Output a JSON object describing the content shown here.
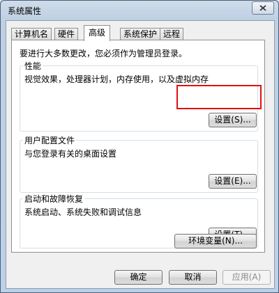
{
  "window": {
    "title": "系统属性"
  },
  "tabs": [
    {
      "label": "计算机名"
    },
    {
      "label": "硬件"
    },
    {
      "label": "高级"
    },
    {
      "label": "系统保护"
    },
    {
      "label": "远程"
    }
  ],
  "active_tab": "高级",
  "panel": {
    "admin_note": "要进行大多数更改，您必须作为管理员登录。",
    "groups": [
      {
        "title": "性能",
        "description": "视觉效果，处理器计划，内存使用，以及虚拟内存",
        "button": "设置(S)..."
      },
      {
        "title": "用户配置文件",
        "description": "与您登录有关的桌面设置",
        "button": "设置(E)..."
      },
      {
        "title": "启动和故障恢复",
        "description": "系统启动、系统失败和调试信息",
        "button": "设置(T)..."
      }
    ],
    "env_button": "环境变量(N)..."
  },
  "footer": {
    "ok": "确定",
    "cancel": "取消",
    "apply": "应用(A)"
  },
  "colors": {
    "highlight": "#e01010",
    "titlebar": "#c5d5e8"
  }
}
